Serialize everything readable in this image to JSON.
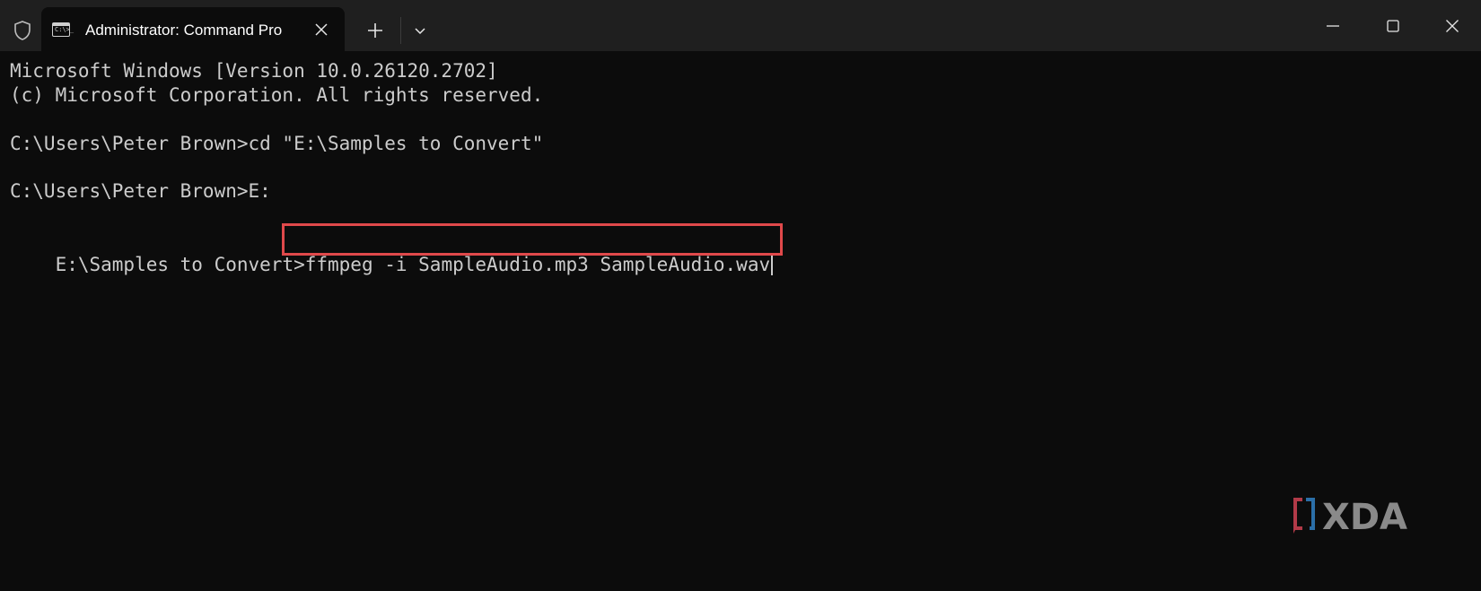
{
  "window": {
    "tab_title": "Administrator: Command Pro",
    "tab_icon_prompt": "C:\\>_"
  },
  "icons": {
    "shield": "shield-icon",
    "tab": "terminal-icon",
    "tab_close": "close-icon",
    "new_tab": "plus-icon",
    "dropdown": "chevron-down-icon",
    "minimize": "minimize-icon",
    "maximize": "maximize-icon",
    "close": "close-icon"
  },
  "terminal": {
    "line1": "Microsoft Windows [Version 10.0.26120.2702]",
    "line2": "(c) Microsoft Corporation. All rights reserved.",
    "line3": "C:\\Users\\Peter Brown>cd \"E:\\Samples to Convert\"",
    "line4": "C:\\Users\\Peter Brown>E:",
    "line5_prompt": "E:\\Samples to Convert>",
    "line5_command": "ffmpeg -i SampleAudio.mp3 SampleAudio.wav"
  },
  "watermark": {
    "text": "XDA"
  },
  "colors": {
    "background": "#0c0c0c",
    "titlebar": "#1f1f1f",
    "text": "#cccccc",
    "highlight_box": "#e0494b",
    "watermark_red": "#b23a48",
    "watermark_blue": "#2b6fa8",
    "watermark_gray": "#8a8a8a"
  }
}
